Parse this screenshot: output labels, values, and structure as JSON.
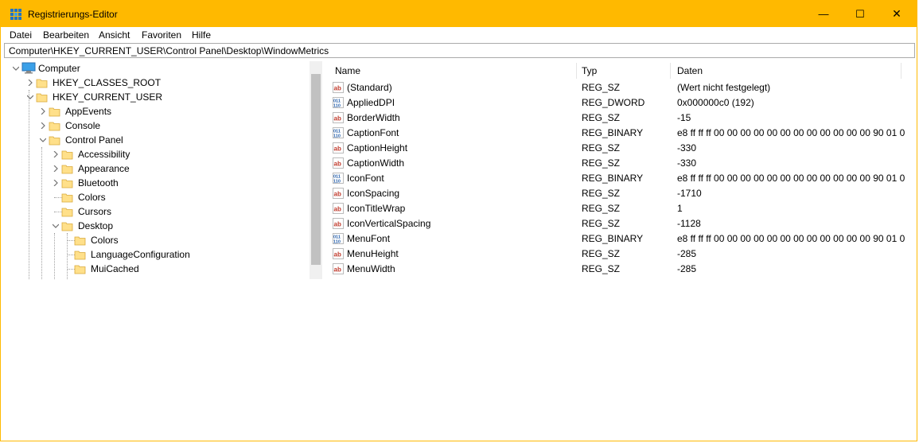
{
  "window": {
    "title": "Registrierungs-Editor",
    "accent_color": "#ffb900"
  },
  "title_buttons": [
    {
      "name": "minimize-button",
      "glyph": "—"
    },
    {
      "name": "maximize-button",
      "glyph": "☐"
    },
    {
      "name": "close-button",
      "glyph": "✕"
    }
  ],
  "menu": [
    "Datei",
    "Bearbeiten",
    "Ansicht",
    "Favoriten",
    "Hilfe"
  ],
  "address": "Computer\\HKEY_CURRENT_USER\\Control Panel\\Desktop\\WindowMetrics",
  "tree": [
    {
      "label": "Computer",
      "level": 0,
      "expander": "open",
      "icon": "computer-icon"
    },
    {
      "label": "HKEY_CLASSES_ROOT",
      "level": 1,
      "expander": "closed",
      "icon": "folder-icon"
    },
    {
      "label": "HKEY_CURRENT_USER",
      "level": 1,
      "expander": "open",
      "icon": "folder-icon"
    },
    {
      "label": "AppEvents",
      "level": 2,
      "expander": "closed",
      "icon": "folder-icon"
    },
    {
      "label": "Console",
      "level": 2,
      "expander": "closed",
      "icon": "folder-icon"
    },
    {
      "label": "Control Panel",
      "level": 2,
      "expander": "open",
      "icon": "folder-icon"
    },
    {
      "label": "Accessibility",
      "level": 3,
      "expander": "closed",
      "icon": "folder-icon"
    },
    {
      "label": "Appearance",
      "level": 3,
      "expander": "closed",
      "icon": "folder-icon"
    },
    {
      "label": "Bluetooth",
      "level": 3,
      "expander": "closed",
      "icon": "folder-icon"
    },
    {
      "label": "Colors",
      "level": 3,
      "expander": "none",
      "icon": "folder-icon"
    },
    {
      "label": "Cursors",
      "level": 3,
      "expander": "none",
      "icon": "folder-icon"
    },
    {
      "label": "Desktop",
      "level": 3,
      "expander": "open",
      "icon": "folder-icon"
    },
    {
      "label": "Colors",
      "level": 4,
      "expander": "none",
      "icon": "folder-icon"
    },
    {
      "label": "LanguageConfiguration",
      "level": 4,
      "expander": "none",
      "icon": "folder-icon"
    },
    {
      "label": "MuiCached",
      "level": 4,
      "expander": "none",
      "icon": "folder-icon"
    }
  ],
  "columns": [
    "Name",
    "Typ",
    "Daten"
  ],
  "values": [
    {
      "icon": "string-value-icon",
      "name": "(Standard)",
      "type": "REG_SZ",
      "data": "(Wert nicht festgelegt)"
    },
    {
      "icon": "binary-value-icon",
      "name": "AppliedDPI",
      "type": "REG_DWORD",
      "data": "0x000000c0 (192)"
    },
    {
      "icon": "string-value-icon",
      "name": "BorderWidth",
      "type": "REG_SZ",
      "data": "-15"
    },
    {
      "icon": "binary-value-icon",
      "name": "CaptionFont",
      "type": "REG_BINARY",
      "data": "e8 ff ff ff 00 00 00 00 00 00 00 00 00 00 00 00 90 01 0..."
    },
    {
      "icon": "string-value-icon",
      "name": "CaptionHeight",
      "type": "REG_SZ",
      "data": "-330"
    },
    {
      "icon": "string-value-icon",
      "name": "CaptionWidth",
      "type": "REG_SZ",
      "data": "-330"
    },
    {
      "icon": "binary-value-icon",
      "name": "IconFont",
      "type": "REG_BINARY",
      "data": "e8 ff ff ff 00 00 00 00 00 00 00 00 00 00 00 00 90 01 0..."
    },
    {
      "icon": "string-value-icon",
      "name": "IconSpacing",
      "type": "REG_SZ",
      "data": "-1710"
    },
    {
      "icon": "string-value-icon",
      "name": "IconTitleWrap",
      "type": "REG_SZ",
      "data": "1"
    },
    {
      "icon": "string-value-icon",
      "name": "IconVerticalSpacing",
      "type": "REG_SZ",
      "data": "-1128"
    },
    {
      "icon": "binary-value-icon",
      "name": "MenuFont",
      "type": "REG_BINARY",
      "data": "e8 ff ff ff 00 00 00 00 00 00 00 00 00 00 00 00 90 01 0..."
    },
    {
      "icon": "string-value-icon",
      "name": "MenuHeight",
      "type": "REG_SZ",
      "data": "-285"
    },
    {
      "icon": "string-value-icon",
      "name": "MenuWidth",
      "type": "REG_SZ",
      "data": "-285"
    }
  ]
}
